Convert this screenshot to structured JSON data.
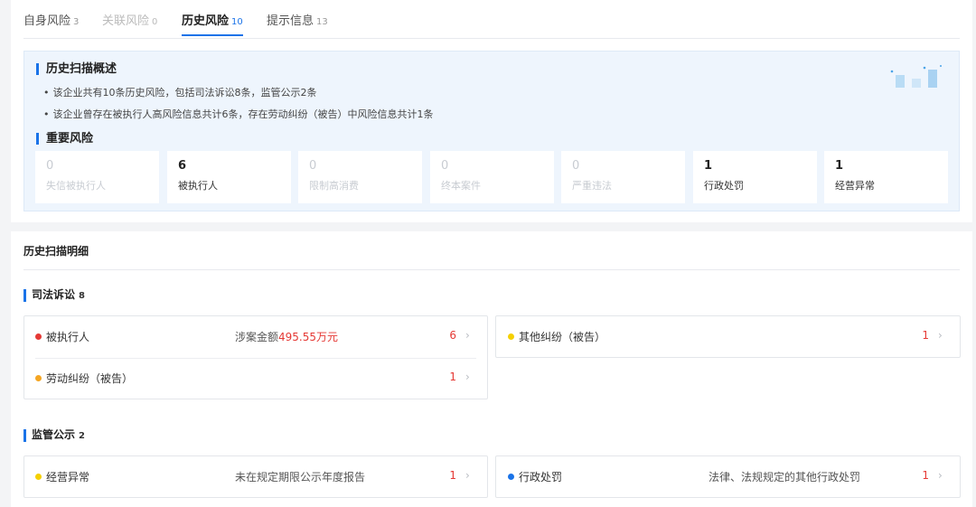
{
  "tabs": [
    {
      "label": "自身风险",
      "count": "3"
    },
    {
      "label": "关联风险",
      "count": "0"
    },
    {
      "label": "历史风险",
      "count": "10"
    },
    {
      "label": "提示信息",
      "count": "13"
    }
  ],
  "overview": {
    "title": "历史扫描概述",
    "bullets": [
      "该企业共有10条历史风险，包括司法诉讼8条，监管公示2条",
      "该企业曾存在被执行人高风险信息共计6条，存在劳动纠纷（被告）中风险信息共计1条"
    ],
    "important_title": "重要风险",
    "risks": [
      {
        "num": "0",
        "label": "失信被执行人"
      },
      {
        "num": "6",
        "label": "被执行人"
      },
      {
        "num": "0",
        "label": "限制高消费"
      },
      {
        "num": "0",
        "label": "终本案件"
      },
      {
        "num": "0",
        "label": "严重违法"
      },
      {
        "num": "1",
        "label": "行政处罚"
      },
      {
        "num": "1",
        "label": "经营异常"
      }
    ]
  },
  "detail": {
    "title": "历史扫描明细",
    "judicial": {
      "title": "司法诉讼",
      "count": "8",
      "items": [
        {
          "name": "被执行人",
          "desc_prefix": "涉案金额",
          "amount": "495.55万元",
          "count": "6",
          "dot": "#e53935"
        },
        {
          "name": "劳动纠纷（被告）",
          "count": "1",
          "dot": "#f5a623"
        },
        {
          "name": "其他纠纷（被告）",
          "count": "1",
          "dot": "#f5d000"
        }
      ]
    },
    "regulatory": {
      "title": "监管公示",
      "count": "2",
      "items": [
        {
          "name": "经营异常",
          "desc": "未在规定期限公示年度报告",
          "count": "1",
          "dot": "#f5d000"
        },
        {
          "name": "行政处罚",
          "desc": "法律、法规规定的其他行政处罚",
          "count": "1",
          "dot": "#1a73e8"
        }
      ]
    }
  },
  "chevron": "›"
}
